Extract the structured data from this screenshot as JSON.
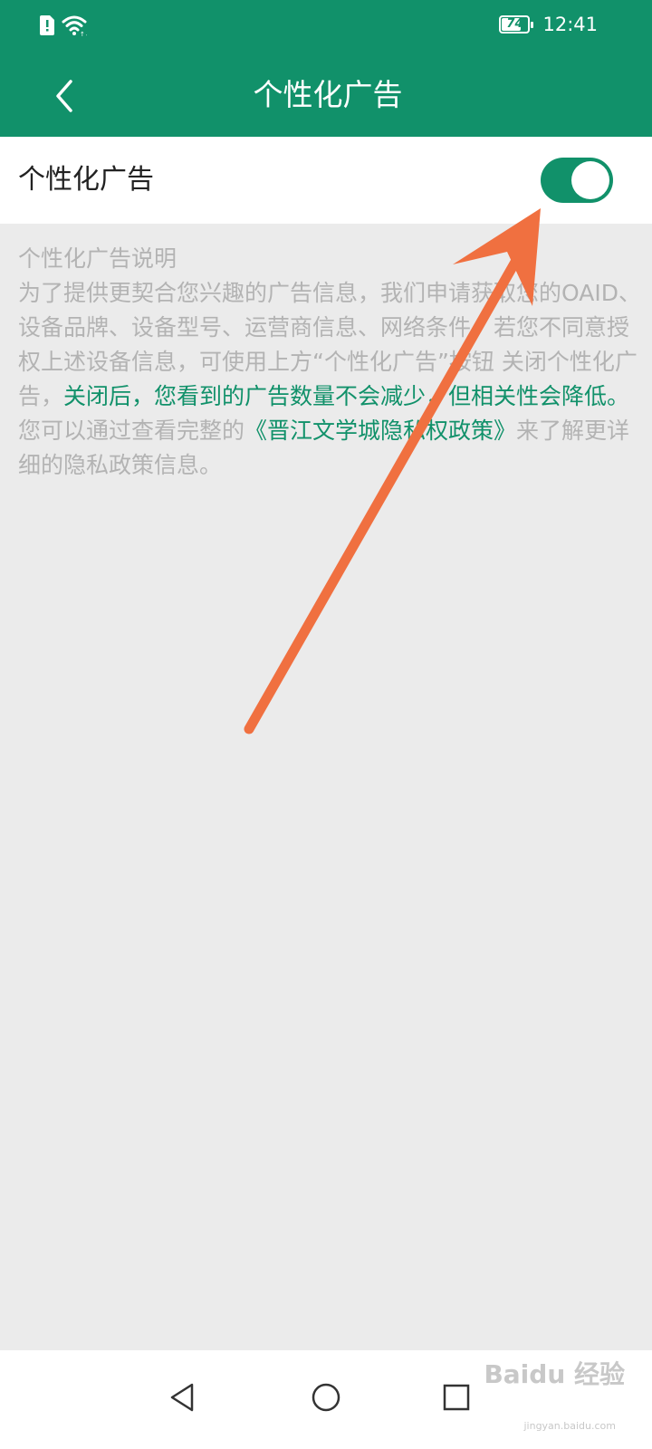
{
  "status_bar": {
    "time": "12:41",
    "battery_level": "74"
  },
  "header": {
    "title": "个性化广告",
    "back_icon": "chevron-left-icon"
  },
  "setting": {
    "label": "个性化广告",
    "toggle_on": true
  },
  "description": {
    "heading": "个性化广告说明",
    "para1_gray": "为了提供更契合您兴趣的广告信息，我们申请获取您的OAID、设备品牌、设备型号、运营商信息、网络条件。若您不同意授权上述设备信息，可使用上方“个性化广告”按钮 关闭个性化广告，",
    "para1_green": "关闭后，您看到的广告数量不会减少，但相关性会降低。",
    "para2_prefix": "您可以通过查看完整的",
    "para2_link": "《晋江文学城隐私权政策》",
    "para2_suffix": "来了解更详细的隐私政策信息。"
  },
  "nav": {
    "back": "triangle-back-icon",
    "home": "circle-home-icon",
    "recents": "square-recents-icon"
  },
  "watermark": {
    "brand": "Baidu 经验",
    "url": "jingyan.baidu.com"
  },
  "colors": {
    "primary": "#11916a",
    "annotation_arrow": "#f07040",
    "background": "#ebebeb"
  }
}
